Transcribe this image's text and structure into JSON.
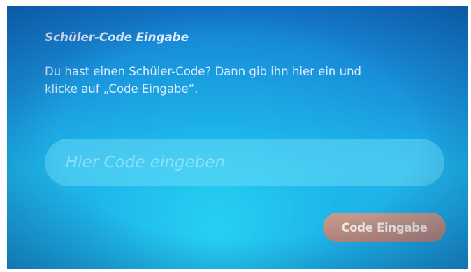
{
  "dialog": {
    "title": "Schüler-Code Eingabe",
    "description_line1": "Du hast einen Schüler-Code? Dann gib ihn hier ein und",
    "description_line2": "klicke auf „Code Eingabe“."
  },
  "code_input": {
    "placeholder": "Hier Code eingeben",
    "value": ""
  },
  "submit_button": {
    "label": "Code Eingabe"
  },
  "colors": {
    "background_top": "#1478cf",
    "background_mid": "#1fb3e8",
    "input_fill": "#5fcff0",
    "button_fill": "#b8877a",
    "text": "#e8f2ff"
  }
}
